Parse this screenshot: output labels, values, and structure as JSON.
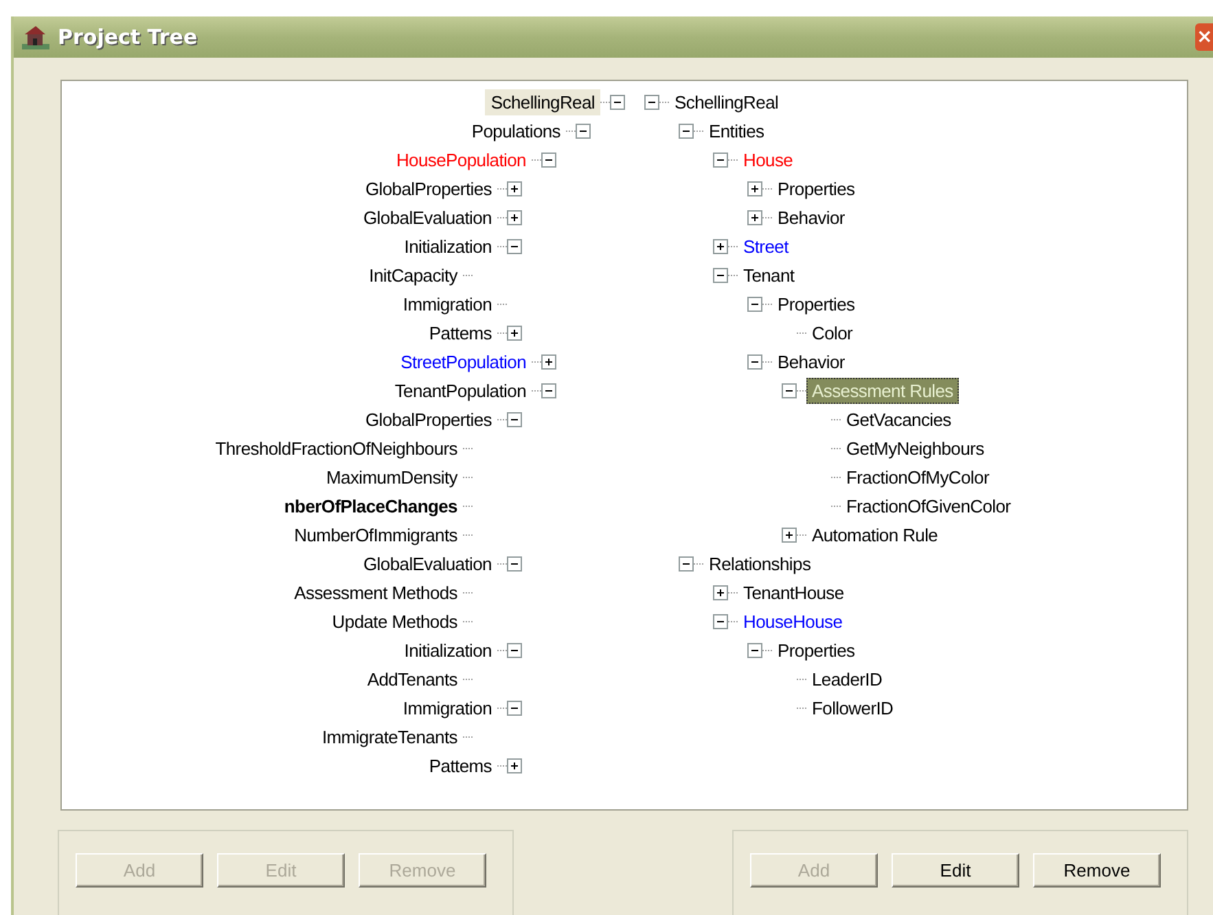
{
  "window": {
    "title": "Project Tree",
    "close_button": "×"
  },
  "left_tree": [
    {
      "label": "SchellingReal",
      "selected": true,
      "expanded": true,
      "children": [
        {
          "label": "Populations",
          "selected": false,
          "expanded": true,
          "children": [
            {
              "label": "HousePopulation",
              "color": "#ff0000",
              "selected": false,
              "expanded": true,
              "children": [
                {
                  "label": "GlobalProperties",
                  "selected": false,
                  "expanded": false
                },
                {
                  "label": "GlobalEvaluation",
                  "selected": false,
                  "expanded": false
                },
                {
                  "label": "Initialization",
                  "selected": false,
                  "expanded": true,
                  "children": [
                    {
                      "label": "InitCapacity",
                      "selected": false
                    }
                  ]
                },
                {
                  "label": "Immigration",
                  "selected": false
                },
                {
                  "label": "Pattems",
                  "selected": false,
                  "expanded": false
                }
              ]
            },
            {
              "label": "StreetPopulation",
              "color": "#0000ff",
              "selected": false,
              "expanded": false
            },
            {
              "label": "TenantPopulation",
              "selected": false,
              "expanded": true,
              "children": [
                {
                  "label": "GlobalProperties",
                  "selected": false,
                  "expanded": true,
                  "children": [
                    {
                      "label": "ThresholdFractionOfNeighbours",
                      "selected": false
                    },
                    {
                      "label": "MaximumDensity",
                      "selected": false
                    },
                    {
                      "label": "nberOfPlaceChanges",
                      "selected": false,
                      "bold": true
                    },
                    {
                      "label": "NumberOfImmigrants",
                      "selected": false
                    }
                  ]
                },
                {
                  "label": "GlobalEvaluation",
                  "selected": false,
                  "expanded": true,
                  "children": [
                    {
                      "label": "Assessment Methods",
                      "selected": false
                    },
                    {
                      "label": "Update Methods",
                      "selected": false
                    }
                  ]
                },
                {
                  "label": "Initialization",
                  "selected": false,
                  "expanded": true,
                  "children": [
                    {
                      "label": "AddTenants",
                      "selected": false
                    }
                  ]
                },
                {
                  "label": "Immigration",
                  "selected": false,
                  "expanded": true,
                  "children": [
                    {
                      "label": "ImmigrateTenants",
                      "selected": false
                    }
                  ]
                },
                {
                  "label": "Pattems",
                  "selected": false,
                  "expanded": false
                }
              ]
            }
          ]
        }
      ]
    }
  ],
  "right_tree": [
    {
      "label": "SchellingReal",
      "selected": false,
      "expanded": true,
      "children": [
        {
          "label": "Entities",
          "selected": false,
          "expanded": true,
          "children": [
            {
              "label": "House",
              "color": "#ff0000",
              "selected": false,
              "expanded": true,
              "children": [
                {
                  "label": "Properties",
                  "selected": false,
                  "expanded": false
                },
                {
                  "label": "Behavior",
                  "selected": false,
                  "expanded": false
                }
              ]
            },
            {
              "label": "Street",
              "color": "#0000ff",
              "selected": false,
              "expanded": false
            },
            {
              "label": "Tenant",
              "selected": false,
              "expanded": true,
              "children": [
                {
                  "label": "Properties",
                  "selected": false,
                  "expanded": true,
                  "children": [
                    {
                      "label": "Color",
                      "selected": false
                    }
                  ]
                },
                {
                  "label": "Behavior",
                  "selected": false,
                  "expanded": true,
                  "children": [
                    {
                      "label": "Assessment Rules",
                      "selected": true,
                      "expanded": true,
                      "children": [
                        {
                          "label": "GetVacancies",
                          "selected": false
                        },
                        {
                          "label": "GetMyNeighbours",
                          "selected": false
                        },
                        {
                          "label": "FractionOfMyColor",
                          "selected": false
                        },
                        {
                          "label": "FractionOfGivenColor",
                          "selected": false
                        }
                      ]
                    },
                    {
                      "label": "Automation Rule",
                      "selected": false,
                      "expanded": false
                    }
                  ]
                }
              ]
            }
          ]
        },
        {
          "label": "Relationships",
          "selected": false,
          "expanded": true,
          "children": [
            {
              "label": "TenantHouse",
              "selected": false,
              "expanded": false
            },
            {
              "label": "HouseHouse",
              "color": "#0000ff",
              "selected": false,
              "expanded": true,
              "children": [
                {
                  "label": "Properties",
                  "selected": false,
                  "expanded": true,
                  "children": [
                    {
                      "label": "LeaderID",
                      "selected": false
                    },
                    {
                      "label": "FollowerID",
                      "selected": false
                    }
                  ]
                }
              ]
            }
          ]
        }
      ]
    }
  ],
  "left_buttons": [
    {
      "label": "Add",
      "disabled": true
    },
    {
      "label": "Edit",
      "disabled": true
    },
    {
      "label": "Remove",
      "disabled": true
    }
  ],
  "right_buttons": [
    {
      "label": "Add",
      "disabled": true
    },
    {
      "label": "Edit",
      "disabled": false
    },
    {
      "label": "Remove",
      "disabled": false
    }
  ]
}
